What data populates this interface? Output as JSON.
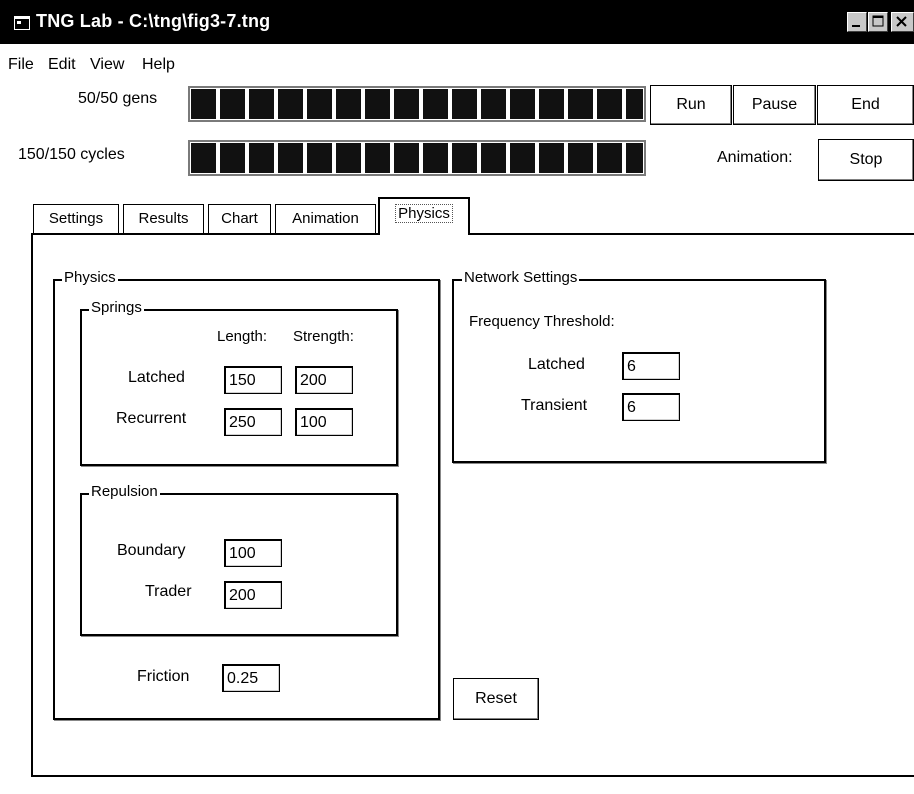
{
  "window": {
    "title": "TNG Lab - C:\\tng\\fig3-7.tng",
    "icon": "app-window-icon",
    "caption_buttons": [
      "minimize-icon",
      "maximize-icon",
      "close-icon"
    ]
  },
  "menu": [
    "File",
    "Edit",
    "View",
    "Help"
  ],
  "progress": {
    "gens": {
      "label": "50/50 gens",
      "fraction": 1.0
    },
    "cycles": {
      "label": "150/150 cycles",
      "fraction": 1.0
    }
  },
  "controls": {
    "run": "Run",
    "pause": "Pause",
    "end": "End",
    "animation_label": "Animation:",
    "animation_button": "Stop"
  },
  "tabs": [
    {
      "label": "Settings",
      "active": false
    },
    {
      "label": "Results",
      "active": false
    },
    {
      "label": "Chart",
      "active": false
    },
    {
      "label": "Animation",
      "active": false
    },
    {
      "label": "Physics",
      "active": true
    }
  ],
  "physics": {
    "title": "Physics",
    "springs": {
      "title": "Springs",
      "length_header": "Length:",
      "strength_header": "Strength:",
      "latched": {
        "label": "Latched",
        "length": "150",
        "strength": "200"
      },
      "recurrent": {
        "label": "Recurrent",
        "length": "250",
        "strength": "100"
      }
    },
    "repulsion": {
      "title": "Repulsion",
      "boundary": {
        "label": "Boundary",
        "value": "100"
      },
      "trader": {
        "label": "Trader",
        "value": "200"
      }
    },
    "friction": {
      "label": "Friction",
      "value": "0.25"
    }
  },
  "network": {
    "title": "Network Settings",
    "frequency_threshold": "Frequency Threshold:",
    "latched": {
      "label": "Latched",
      "value": "6"
    },
    "transient": {
      "label": "Transient",
      "value": "6"
    }
  },
  "reset": "Reset"
}
